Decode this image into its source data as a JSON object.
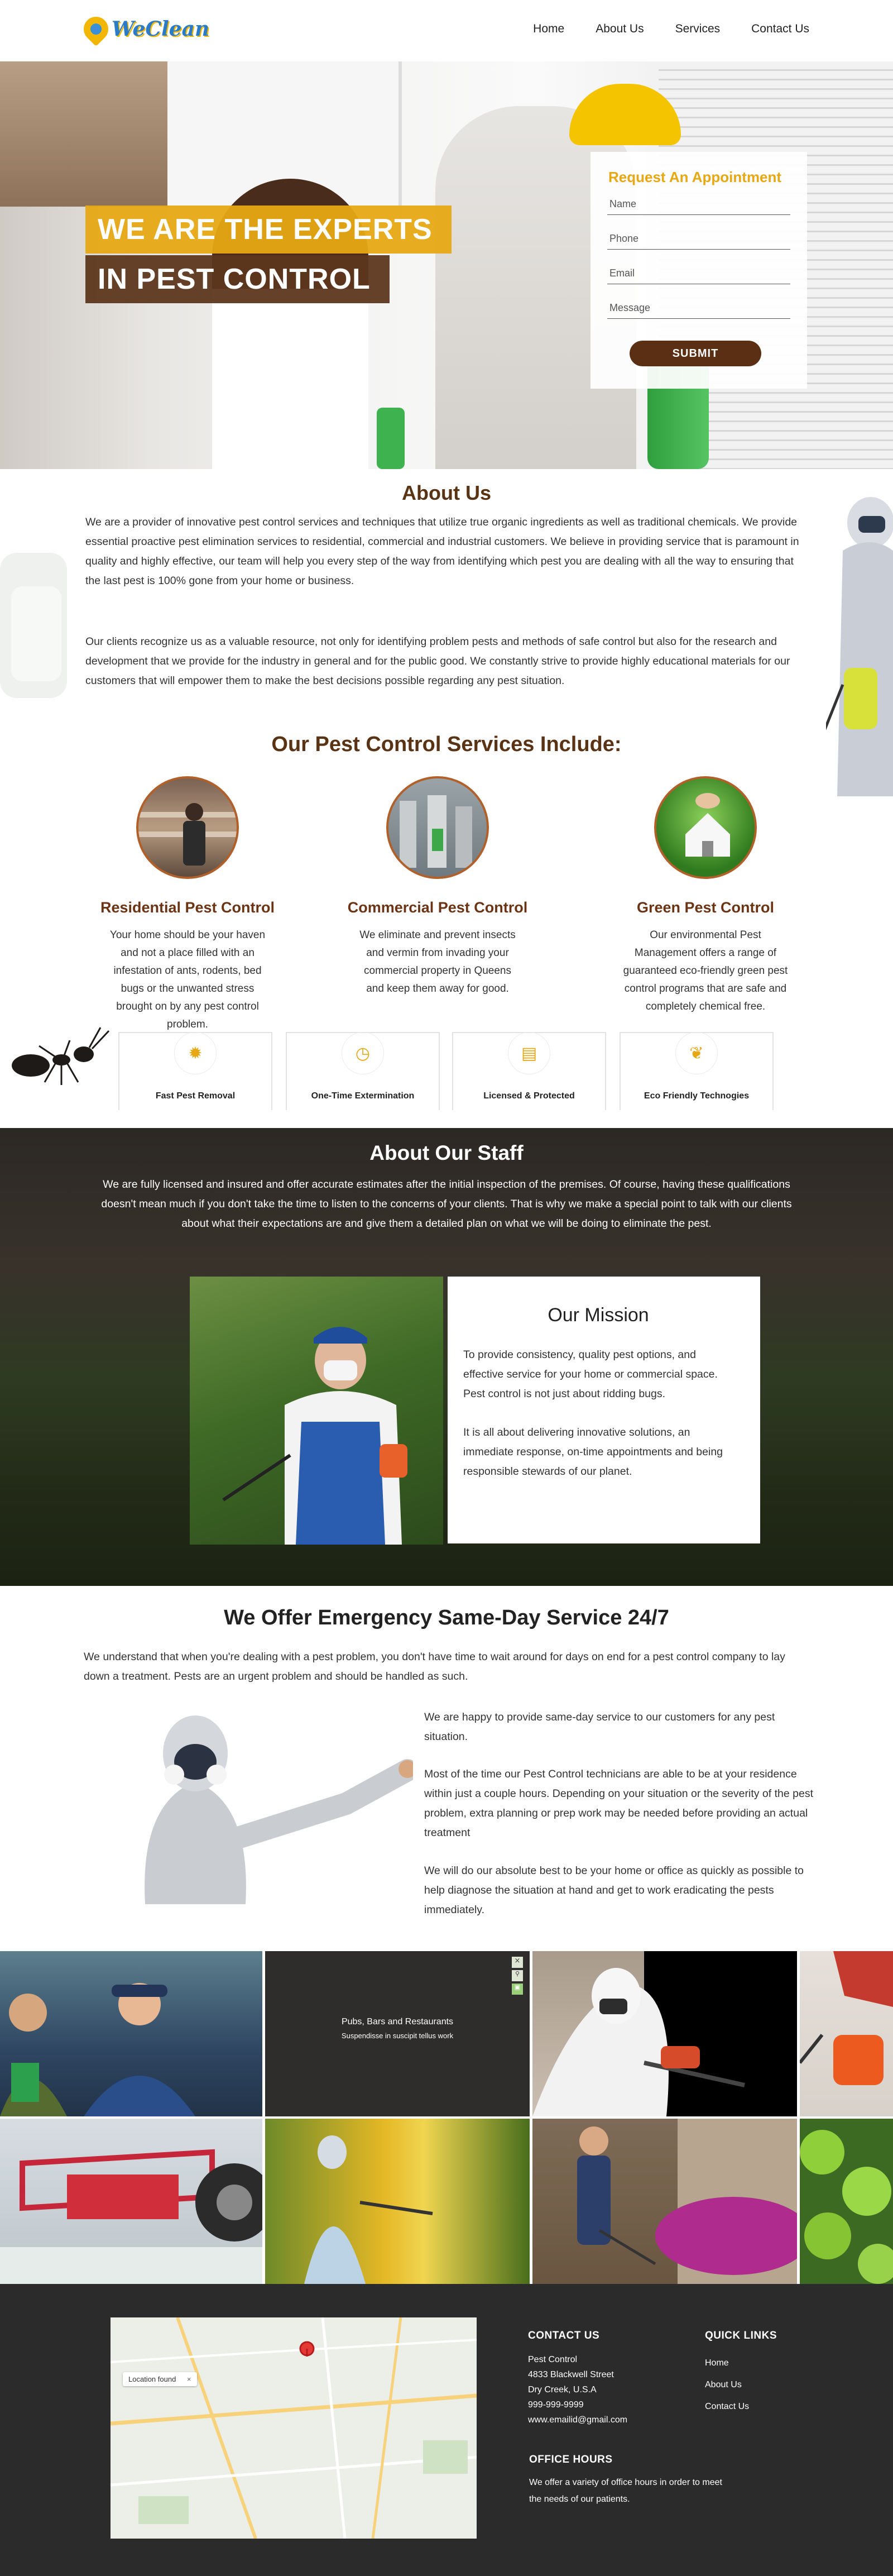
{
  "header": {
    "logo_text": "WeClean",
    "nav": [
      "Home",
      "About Us",
      "Services",
      "Contact Us"
    ]
  },
  "hero": {
    "line1": "WE ARE THE EXPERTS",
    "line2": "IN PEST CONTROL"
  },
  "appointment": {
    "title": "Request An Appointment",
    "name_placeholder": "Name",
    "phone_placeholder": "Phone",
    "email_placeholder": "Email",
    "message_placeholder": "Message",
    "submit_label": "SUBMIT"
  },
  "about": {
    "title": "About Us",
    "p1": "We are a provider of innovative pest control services and techniques that utilize true organic ingredients as well as traditional chemicals. We provide essential proactive pest elimination services to residential, commercial and industrial customers. We believe in providing service that is paramount in quality and highly effective, our team will help you every step of the way from identifying which pest you are dealing with all the way to ensuring that the last pest is 100% gone from your home or business.",
    "p2": "Our clients recognize us as a valuable resource, not only for identifying problem pests and methods of safe control but also for the research and development that we provide for the industry in general and for the public good. We constantly strive to provide highly educational materials for our customers that will empower them to make the best decisions possible regarding any pest situation."
  },
  "services": {
    "title": "Our Pest Control Services Include:",
    "items": [
      {
        "title": "Residential Pest Control",
        "text": "Your home should be your haven and not a place filled with an infestation of ants, rodents, bed bugs or the unwanted stress brought on by any pest control problem."
      },
      {
        "title": "Commercial Pest Control",
        "text": "We eliminate and prevent insects and vermin from invading your commercial property in Queens and keep them away for good."
      },
      {
        "title": "Green Pest Control",
        "text": "Our environmental Pest Management offers a range of guaranteed eco-friendly green pest control programs that are safe and completely chemical free."
      }
    ],
    "features": [
      {
        "label": "Fast Pest Removal",
        "icon": "bug-icon"
      },
      {
        "label": "One-Time Extermination",
        "icon": "clock-icon"
      },
      {
        "label": "Licensed & Protected",
        "icon": "certificate-icon"
      },
      {
        "label": "Eco Friendly Technogies",
        "icon": "leaf-icon"
      }
    ]
  },
  "staff": {
    "title": "About Our Staff",
    "text": "We are fully licensed and insured and offer accurate estimates after the initial inspection of the premises. Of course, having these qualifications doesn't mean much if you don't take the time to listen to the concerns of your clients. That is why we make a special point to talk with our clients about what their expectations are and give them a detailed plan on what we will be doing to eliminate the pest.",
    "mission_title": "Our Mission",
    "mission_p1": "To provide consistency, quality pest options, and effective service for your home or commercial space. Pest control is not just about ridding bugs.",
    "mission_p2": "It is all about delivering innovative solutions, an immediate response, on-time appointments and being responsible stewards of our planet."
  },
  "emergency": {
    "title": "We Offer Emergency Same-Day Service 24/7",
    "p0": "We understand that when you're dealing with a pest problem, you don't have time to wait around for days on end for a pest control company to lay down a treatment. Pests are an urgent problem and should be handled as such.",
    "p1": "We are happy to provide same-day service to our customers for any pest situation.",
    "p2": "Most of the time our Pest Control technicians are able to be at your residence within just a couple hours. Depending on your situation or the severity of the pest problem, extra planning or prep work may be needed before providing an actual treatment",
    "p3": "We will do our absolute best to be your home or office as quickly as possible to help diagnose the situation at hand and get to work eradicating the pests immediately."
  },
  "gallery": {
    "caption_title": "Pubs, Bars and Restaurants",
    "caption_sub": "Suspendisse in suscipit tellus work"
  },
  "footer": {
    "map_label": "Location found",
    "contact_title": "CONTACT US",
    "contact_lines": [
      "Pest Control",
      "4833  Blackwell Street",
      "Dry Creek, U.S.A",
      "999-999-9999",
      "www.emailid@gmail.com"
    ],
    "quick_title": "QUICK LINKS",
    "quick_links": [
      "Home",
      "About Us",
      "Contact Us"
    ],
    "hours_title": "OFFICE HOURS",
    "hours_text_1": "We offer a variety of office hours in order to meet",
    "hours_text_2": "the needs of our patients."
  },
  "colors": {
    "accent": "#e6a814",
    "brown": "#5a3214",
    "footer": "#2b2b2b"
  }
}
